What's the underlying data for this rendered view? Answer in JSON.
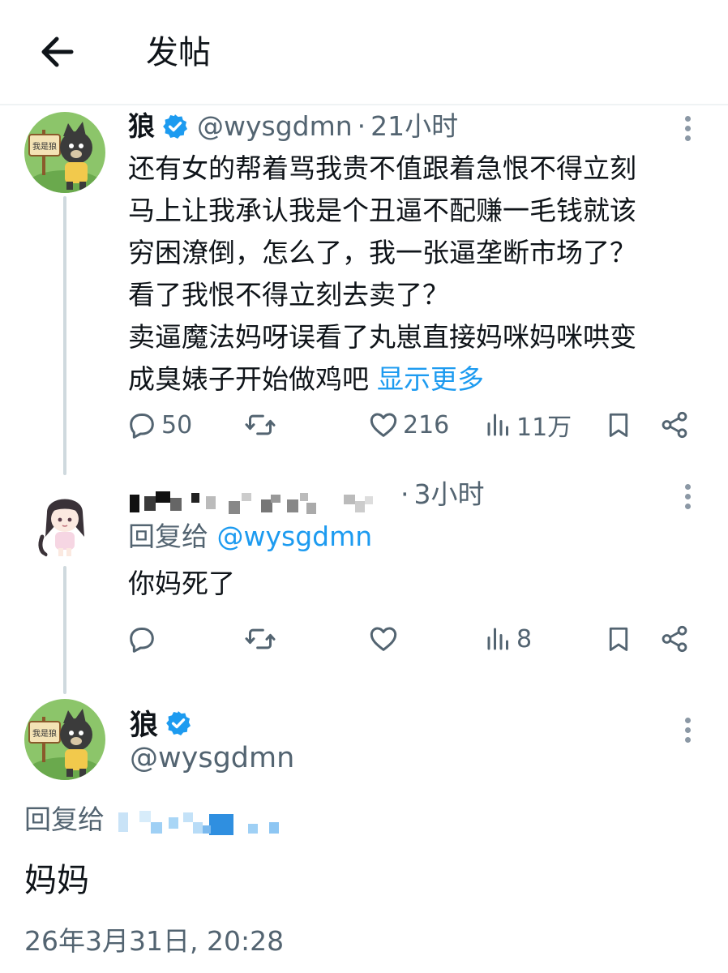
{
  "header": {
    "title": "发帖",
    "back_icon": "arrow-left-icon"
  },
  "tweet1": {
    "name": "狼",
    "handle": "@wysgdmn",
    "separator": "·",
    "time": "21小时",
    "lines": [
      "还有女的帮着骂我贵不值跟着急恨不得立刻",
      "马上让我承认我是个丑逼不配赚一毛钱就该",
      "穷困潦倒，怎么了，我一张逼垄断市场了？",
      "看了我恨不得立刻去卖了？",
      "卖逼魔法妈呀误看了丸崽直接妈咪妈咪哄变",
      "成臭婊子开始做鸡吧"
    ],
    "show_more": "显示更多",
    "replies": "50",
    "likes": "216",
    "views": "11万",
    "avatar_sign_text": "我是狼"
  },
  "tweet2": {
    "separator": "·",
    "time": "3小时",
    "reply_prefix": "回复给",
    "reply_mention": "@wysgdmn",
    "text": "你妈死了",
    "views": "8"
  },
  "main_tweet": {
    "name": "狼",
    "handle": "@wysgdmn",
    "reply_prefix": "回复给",
    "text": "妈妈",
    "date": "26年3月31日, 20:28"
  },
  "colors": {
    "link": "#1d9bf0",
    "secondary": "#536471",
    "verified": "#1d9bf0",
    "divider": "#eff3f4"
  }
}
